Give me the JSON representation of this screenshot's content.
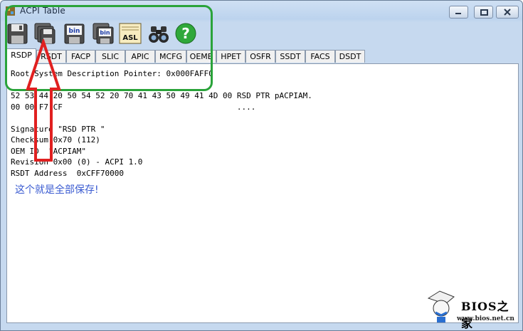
{
  "window": {
    "title": "ACPI Table"
  },
  "toolbar": {
    "buttons": [
      {
        "name": "save-all",
        "icon": "floppy-disk-icon"
      },
      {
        "name": "save",
        "icon": "stacked-floppy-icon"
      },
      {
        "name": "save-bin",
        "icon": "floppy-bin-icon",
        "label": "bin"
      },
      {
        "name": "save-all-bin",
        "icon": "stacked-floppy-bin-icon",
        "label": "bin"
      },
      {
        "name": "save-asl",
        "icon": "asl-document-icon",
        "label": "ASL"
      },
      {
        "name": "find",
        "icon": "binoculars-icon"
      },
      {
        "name": "help",
        "icon": "help-icon",
        "label": "?"
      }
    ]
  },
  "tabs": [
    "RSDP",
    "RSDT",
    "FACP",
    "SLIC",
    "APIC",
    "MCFG",
    "OEMB",
    "HPET",
    "OSFR",
    "SSDT",
    "FACS",
    "DSDT"
  ],
  "active_tab": "RSDP",
  "content": {
    "lines": [
      "Root System Description Pointer: 0x000FAFF0",
      "",
      "52 53 44 20 50 54 52 20 70 41 43 50 49 41 4D 00 RSD PTR pACPIAM.",
      "00 00 F7 CF                                     ....",
      "",
      "Signature \"RSD PTR \"",
      "Checksum 0x70 (112)",
      "OEM ID  \"ACPIAM\"",
      "Revision 0x00 (0) - ACPI 1.0",
      "RSDT Address  0xCFF70000"
    ]
  },
  "annotation": {
    "text": "这个就是全部保存!",
    "color": "#3a5bd1"
  },
  "highlight": {
    "box_color": "#2aa33a",
    "arrow_color": "#e02020"
  },
  "watermark": {
    "title": "BIOS之家",
    "url": "www.bios.net.cn"
  }
}
